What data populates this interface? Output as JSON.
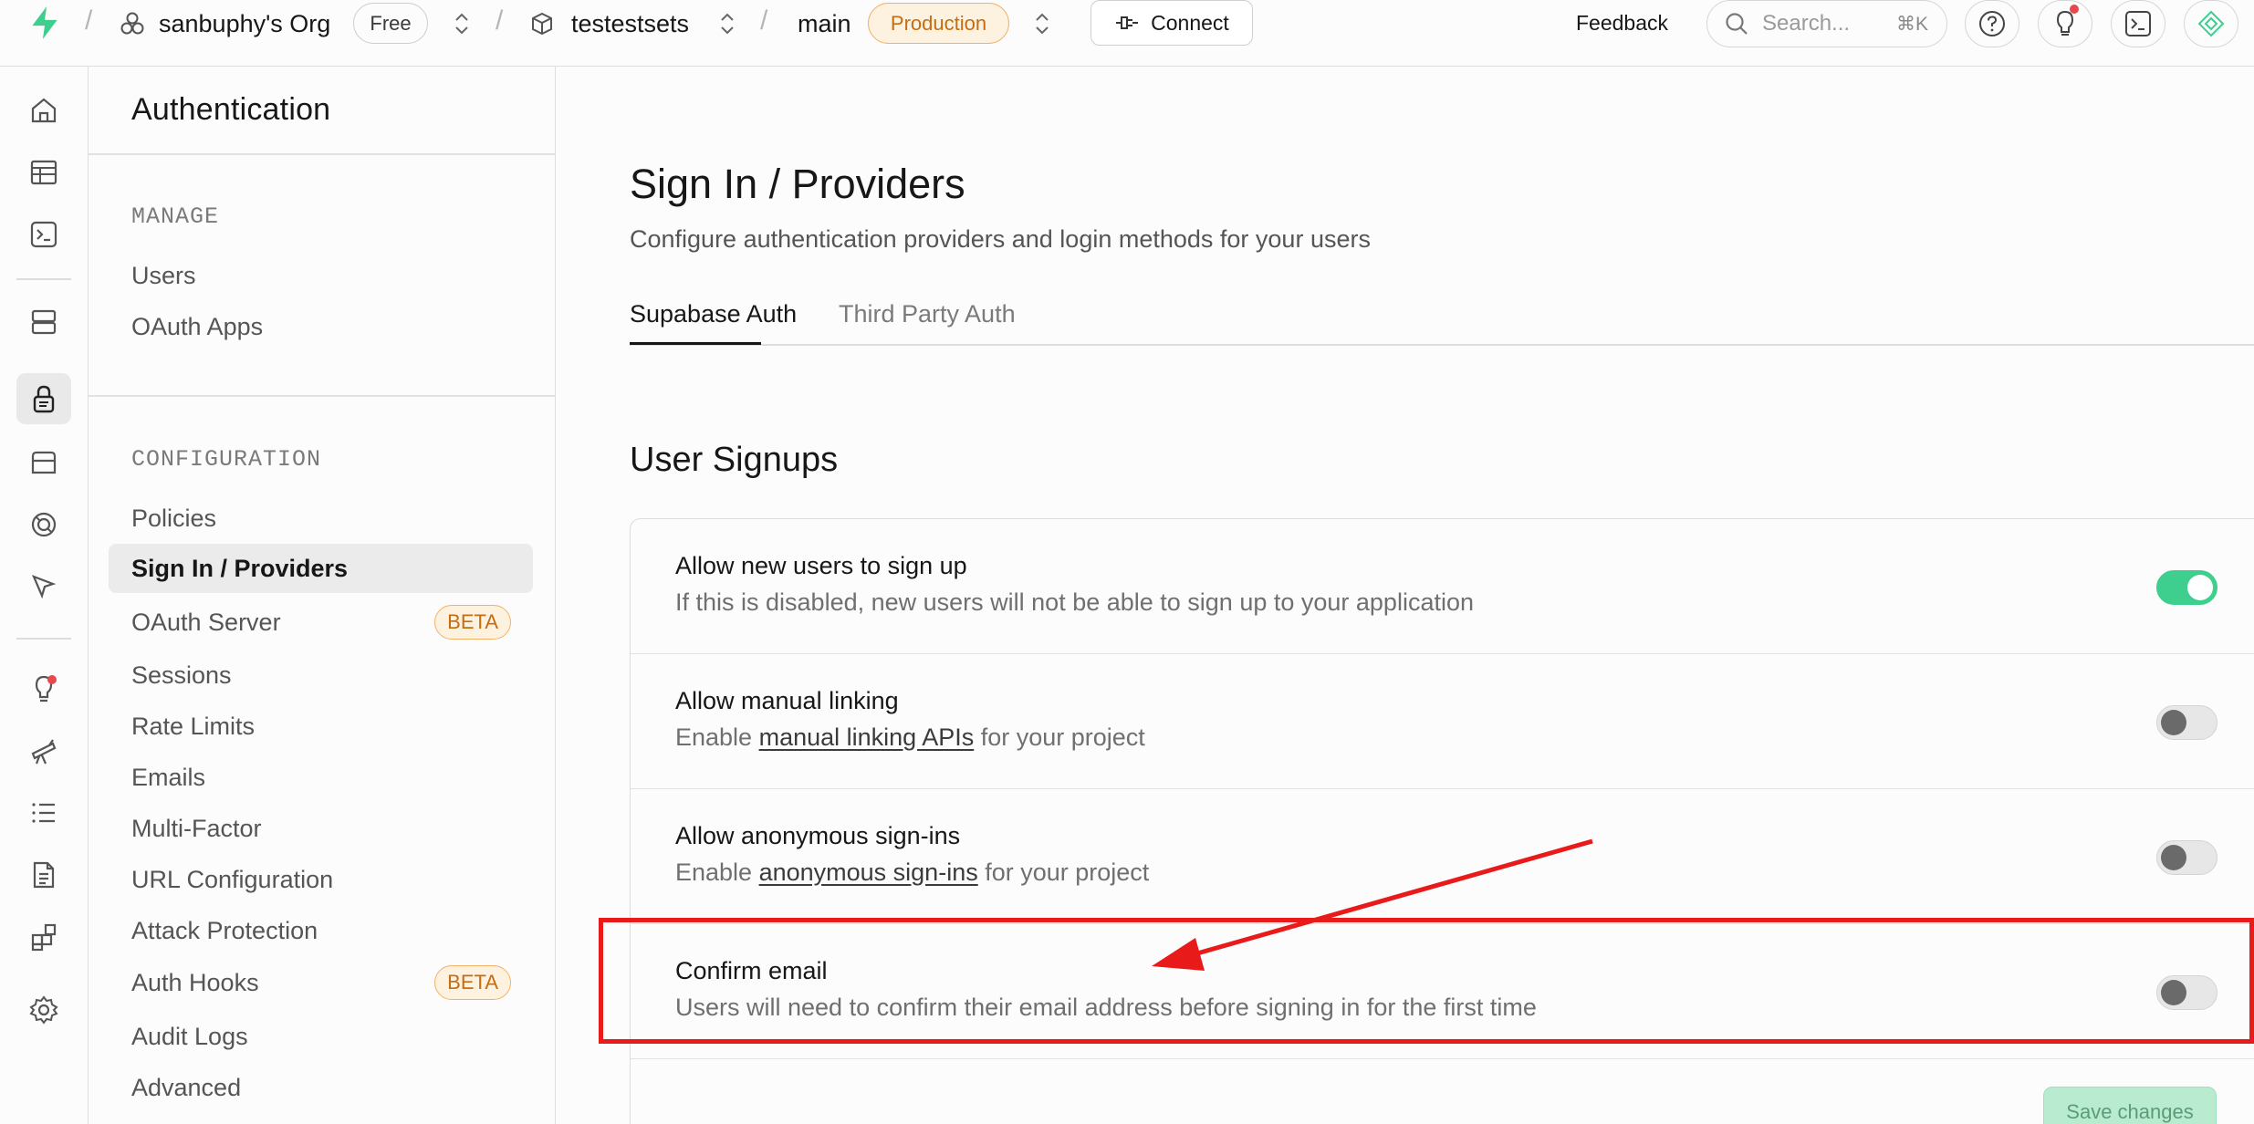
{
  "topbar": {
    "org_name": "sanbuphy's Org",
    "org_plan": "Free",
    "project_name": "testestsets",
    "branch_name": "main",
    "branch_env": "Production",
    "connect_label": "Connect",
    "feedback_label": "Feedback",
    "search_placeholder": "Search...",
    "search_shortcut": "⌘K"
  },
  "subside": {
    "title": "Authentication",
    "manage_title": "MANAGE",
    "manage_items": [
      "Users",
      "OAuth Apps"
    ],
    "config_title": "CONFIGURATION",
    "config_items": [
      "Policies",
      "Sign In / Providers",
      "OAuth Server",
      "Sessions",
      "Rate Limits",
      "Emails",
      "Multi-Factor",
      "URL Configuration",
      "Attack Protection",
      "Auth Hooks",
      "Audit Logs",
      "Advanced"
    ],
    "active_item": "Sign In / Providers",
    "beta_label": "BETA"
  },
  "main": {
    "title": "Sign In / Providers",
    "subtitle": "Configure authentication providers and login methods for your users",
    "tabs": [
      "Supabase Auth",
      "Third Party Auth"
    ],
    "active_tab": "Supabase Auth",
    "section_title": "User Signups",
    "rows": [
      {
        "title": "Allow new users to sign up",
        "desc_pre": "If this is disabled, new users will not be able to sign up to your application",
        "link": "",
        "desc_post": "",
        "enabled": true
      },
      {
        "title": "Allow manual linking",
        "desc_pre": "Enable ",
        "link": "manual linking APIs",
        "desc_post": " for your project",
        "enabled": false
      },
      {
        "title": "Allow anonymous sign-ins",
        "desc_pre": "Enable ",
        "link": "anonymous sign-ins",
        "desc_post": " for your project",
        "enabled": false
      },
      {
        "title": "Confirm email",
        "desc_pre": "Users will need to confirm their email address before signing in for the first time",
        "link": "",
        "desc_post": "",
        "enabled": false
      }
    ],
    "save_label": "Save changes"
  },
  "colors": {
    "accent": "#3ecf8e",
    "production_bg": "#fdf1e0",
    "production_text": "#c56d11",
    "annotation": "#e81a1a"
  },
  "icons": {
    "rail": [
      "home-icon",
      "table-editor-icon",
      "sql-editor-icon",
      "database-icon",
      "authentication-icon",
      "storage-icon",
      "edge-functions-icon",
      "realtime-icon",
      "advisors-icon",
      "reports-icon",
      "logs-icon",
      "api-docs-icon",
      "integrations-icon",
      "settings-icon"
    ]
  }
}
